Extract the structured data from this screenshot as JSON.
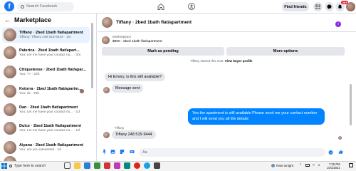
{
  "topbar": {
    "logo": "f",
    "search_placeholder": "Search Facebook",
    "find_friends": "Find friends",
    "notification_badge": "20+"
  },
  "sidebar": {
    "title": "Marketplace",
    "conversations": [
      {
        "name": "Tiffany · 2bed 1bath flat/apartment",
        "sub": "Tiffany: Tiffany 248 515-9444 · 1m",
        "active": true
      },
      {
        "name": "Paterica · 2bed 1bath flat/apart...",
        "sub": "You: Let me have your contact nu... · 3m",
        "active": false
      },
      {
        "name": "Chiquelense · 2bed 1bath flat/apar...",
        "sub": "You: ?? · 23h",
        "active": false
      },
      {
        "name": "Ketorra · 2bed 1bath flat/apartm...",
        "sub": "You: ok · 23h",
        "active": false
      },
      {
        "name": "Dan · 2bed 1bath flat/apartment",
        "sub": "You: Let me have your contact nu... · 1d",
        "active": false
      },
      {
        "name": "Dulce · 2bed 1bath flat/apartment",
        "sub": "You: Let me have your contact nu... · 1d",
        "active": false
      },
      {
        "name": "Aiyana · 2bed 1bath flat/apartment",
        "sub": "You: are you interested · 1d",
        "active": false
      },
      {
        "name": "",
        "sub": "",
        "active": false
      }
    ]
  },
  "chat": {
    "title": "Tiffany · 2bed 1bath flat/apartment",
    "listing_label": "Marketplace",
    "listing_price": "$900 · 2bed 1bath flat/apartment",
    "mark_pending": "Mark as pending",
    "more_options": "More options",
    "started_text": "Tiffany started this chat.",
    "view_profile": "View buyer profile",
    "messages": {
      "m1": "Hi Emory, is this still available?",
      "m2": "Message sent",
      "m3": "Yes the apartment is still available Please send me your contact number and I will send you all the details",
      "sender": "Tiffany",
      "m4": "Tiffany 248 515-9444"
    },
    "composer_placeholder": "Aa"
  },
  "taskbar": {
    "search_text": "Type here to search",
    "weather": "Rain tonight",
    "time": "7:25 PM",
    "date": "10/1/2021"
  },
  "colors": {
    "brand": "#1877f2",
    "outgoing_bubble": "#0084ff",
    "active_row": "#e7f3ff"
  }
}
